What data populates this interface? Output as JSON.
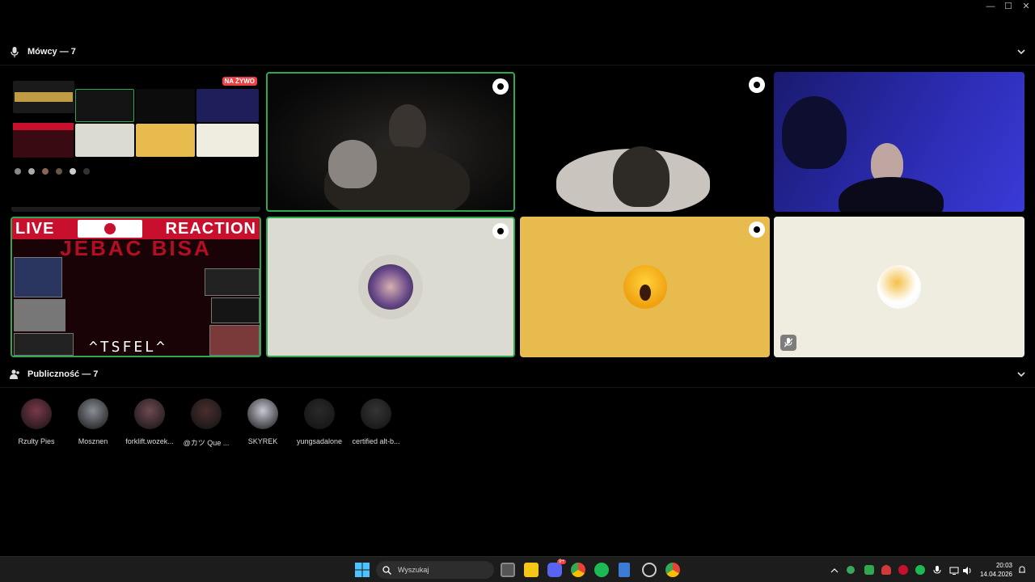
{
  "window": {
    "minimize_glyph": "—",
    "maximize_glyph": "☐",
    "close_glyph": "✕"
  },
  "speakers": {
    "title": "Mówcy — 7",
    "icon": "microphone-icon",
    "collapse_icon": "chevron-down-icon"
  },
  "screen_share": {
    "live_badge": "NA ŻYWO"
  },
  "reaction_stream": {
    "left_word": "LIVE",
    "right_word": "REACTION",
    "subtitle": "JEBAC BISA",
    "signature": "^TSFEL^"
  },
  "audience": {
    "title": "Publiczność — 7",
    "icon": "audience-icon",
    "members": [
      {
        "name": "Rzulty Pies",
        "color": "#7a3a4a"
      },
      {
        "name": "Mosznen",
        "color": "#8a8e96"
      },
      {
        "name": "forklift.wozek...",
        "color": "#6e4a52"
      },
      {
        "name": "@カツ Que ...",
        "color": "#4a2e2e"
      },
      {
        "name": "SKYREK",
        "color": "#c8c8d4"
      },
      {
        "name": "yungsadalone",
        "color": "#2a2a2a"
      },
      {
        "name": "certified alt-b...",
        "color": "#353535"
      }
    ]
  },
  "taskbar": {
    "search_placeholder": "Wyszukaj",
    "time": "20:03",
    "date": "14.04.2026",
    "discord_badge": "9+"
  },
  "colors": {
    "speaking_border": "#2fa84f",
    "live_red": "#ed4245",
    "yellow_tile": "#e8bb4e",
    "cream_tile": "#efede0",
    "grey_tile": "#dcdbd2"
  }
}
